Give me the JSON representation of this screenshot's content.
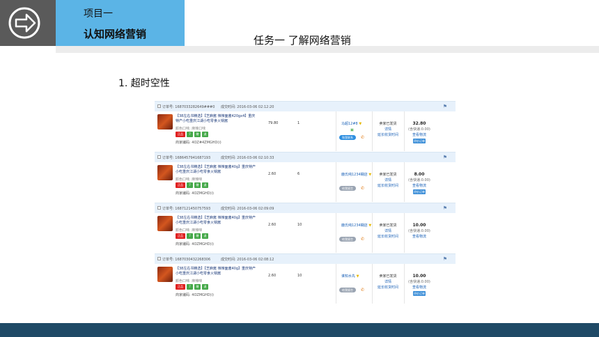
{
  "header": {
    "project_label": "项目一",
    "project_title": "认知网络营销",
    "task_title": "任务一   了解网络营销"
  },
  "section": {
    "title": "1. 超时空性"
  },
  "orders": [
    {
      "order_no": "订单号: 1687033282649###0",
      "deal_time": "成交时间: 2016-03-06 02:12:20",
      "product_name": "【38左右书精选】【芝麻酱 辣辣面酱420gx4】重庆特产小吃重庆江湖小吃零食火锅酱",
      "product_sub": "颜色口味: 麻辣口味",
      "tags": [
        "正品",
        "7",
        "赠",
        "退"
      ],
      "product_code": "商家编码: 4OZ#4ZMGHD(i)",
      "price": "79.80",
      "qty": "1",
      "buyer": "马超12#8",
      "contact": "和我联系",
      "contact_style": "blue",
      "status": "卖家已发货",
      "status_link1": "详情",
      "status_link2": "延长收货时间",
      "total": "32.80",
      "total_note": "(含快递:0.00)",
      "total_link": "查看物流",
      "total_btn": "评价订单"
    },
    {
      "order_no": "订单号: 1686457941687193",
      "deal_time": "成交时间: 2016-03-06 02:10:33",
      "product_name": "【38左右书精选】【芝麻酱 辣辣面酱40g】重庆特产小吃重庆江湖小吃零食火锅酱",
      "product_sub": "颜色口味: 麻辣味",
      "tags": [
        "正品",
        "7",
        "赠",
        "退"
      ],
      "product_code": "商家编码: 4OZMGHD(i)",
      "price": "2.60",
      "qty": "6",
      "buyer": "鹿氏纯1234糊店",
      "contact": "给我留言",
      "contact_style": "grey",
      "status": "卖家已发货",
      "status_link1": "详情",
      "status_link2": "延长收货时间",
      "total": "8.00",
      "total_note": "(含快递:0.00)",
      "total_link": "查看物流",
      "total_btn": "评价订单"
    },
    {
      "order_no": "订单号: 1687121450757593",
      "deal_time": "成交时间: 2016-03-06 02:09:09",
      "product_name": "【38左右书精选】【芝麻酱 辣辣面酱40g】重庆特产小吃重庆江湖小吃零食火锅酱",
      "product_sub": "颜色口味: 麻辣味",
      "tags": [
        "正品",
        "7",
        "赠",
        "退"
      ],
      "product_code": "商家编码: 4OZMGHD(i)",
      "price": "2.60",
      "qty": "10",
      "buyer": "鹿氏纯1234糊店",
      "contact": "给我留言",
      "contact_style": "grey",
      "status": "卖家已发货",
      "status_link1": "详情",
      "status_link2": "延长收货时间",
      "total": "10.00",
      "total_note": "(含快递:0.00)",
      "total_link": "查看物流",
      "total_btn": ""
    },
    {
      "order_no": "订单号: 1687030432268306",
      "deal_time": "成交时间: 2016-03-06 02:08:12",
      "product_name": "【38左右书精选】【芝麻酱 辣辣面酱40g】重庆特产小吃重庆江湖小吃零食火锅酱",
      "product_sub": "颜色口味: 麻辣味",
      "tags": [
        "正品",
        "7",
        "赠",
        "退"
      ],
      "product_code": "商家编码: 4OZMGHD(i)",
      "price": "2.60",
      "qty": "10",
      "buyer": "谁知水先",
      "contact": "给我留言",
      "contact_style": "grey",
      "status": "卖家已发货",
      "status_link1": "详情",
      "status_link2": "延长收货时间",
      "total": "10.00",
      "total_note": "(含快递:0.00)",
      "total_link": "查看物流",
      "total_btn": "评价订单"
    }
  ]
}
